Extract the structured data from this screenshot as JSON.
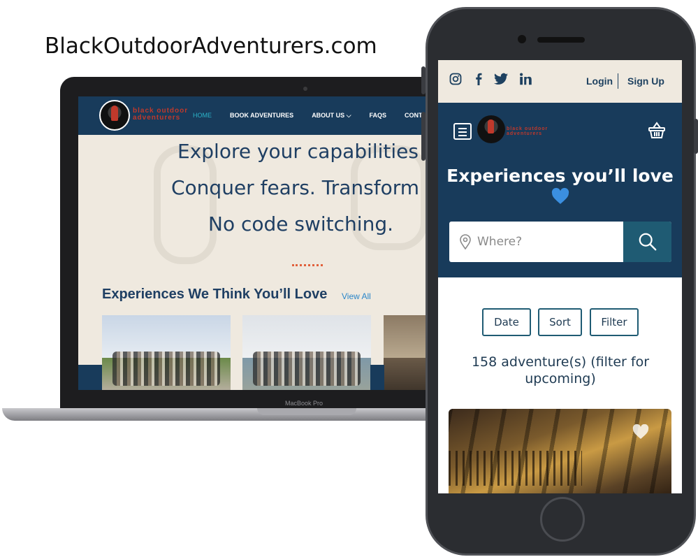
{
  "caption": "BlackOutdoorAdventurers.com",
  "colors": {
    "navy": "#183b5b",
    "cream": "#efe9df",
    "teal": "#1f5b73",
    "accent_red": "#c0392b",
    "dots_orange": "#e1603c"
  },
  "laptop": {
    "model": "MacBook Pro",
    "brand": {
      "line1": "black outdoor",
      "line2": "adventurers"
    },
    "nav": [
      {
        "label": "HOME",
        "active": true
      },
      {
        "label": "BOOK ADVENTURES"
      },
      {
        "label": "ABOUT US ⌵"
      },
      {
        "label": "FAQS"
      },
      {
        "label": "CONTACT US"
      }
    ],
    "hero_lines": [
      "Explore your capabilities",
      "Conquer fears. Transform",
      "No code switching."
    ],
    "experiences_title": "Experiences We Think You’ll Love",
    "view_all": "View All"
  },
  "phone": {
    "social_icons": [
      "instagram-icon",
      "facebook-icon",
      "twitter-icon",
      "linkedin-icon"
    ],
    "login": "Login",
    "signup": "Sign Up",
    "brand": {
      "line1": "black outdoor",
      "line2": "adventurers"
    },
    "hero_title": "Experiences you’ll love",
    "search_placeholder": "Where?",
    "filter_buttons": [
      "Date",
      "Sort",
      "Filter"
    ],
    "count_text": "158 adventure(s) (filter for upcoming)"
  }
}
